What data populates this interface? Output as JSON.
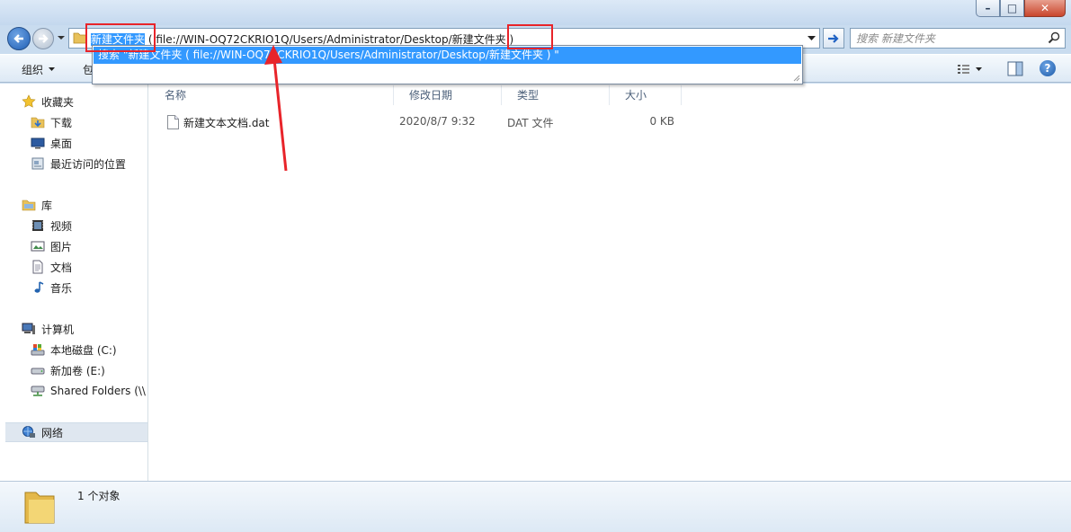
{
  "address": {
    "selected_text": "新建文件夹",
    "rest_text": " ( file://WIN-OQ72CKRIO1Q/Users/Administrator/Desktop/新建文件夹 )"
  },
  "search": {
    "placeholder": "搜索 新建文件夹"
  },
  "autocomplete": {
    "item": "搜索 \"新建文件夹 ( file://WIN-OQ72CKRIO1Q/Users/Administrator/Desktop/新建文件夹 ) \""
  },
  "toolbar": {
    "organize": "组织",
    "include": "包"
  },
  "sidebar": {
    "favorites": {
      "label": "收藏夹",
      "items": [
        "下载",
        "桌面",
        "最近访问的位置"
      ]
    },
    "libraries": {
      "label": "库",
      "items": [
        "视频",
        "图片",
        "文档",
        "音乐"
      ]
    },
    "computer": {
      "label": "计算机",
      "items": [
        "本地磁盘 (C:)",
        "新加卷 (E:)",
        "Shared Folders (\\\\"
      ]
    },
    "network": {
      "label": "网络"
    }
  },
  "columns": {
    "name": "名称",
    "date": "修改日期",
    "type": "类型",
    "size": "大小"
  },
  "files": [
    {
      "name": "新建文本文档.dat",
      "date": "2020/8/7 9:32",
      "type": "DAT 文件",
      "size": "0 KB"
    }
  ],
  "status": {
    "count": "1 个对象"
  },
  "colors": {
    "annotation": "#e8242a",
    "selection": "#3399ff"
  }
}
